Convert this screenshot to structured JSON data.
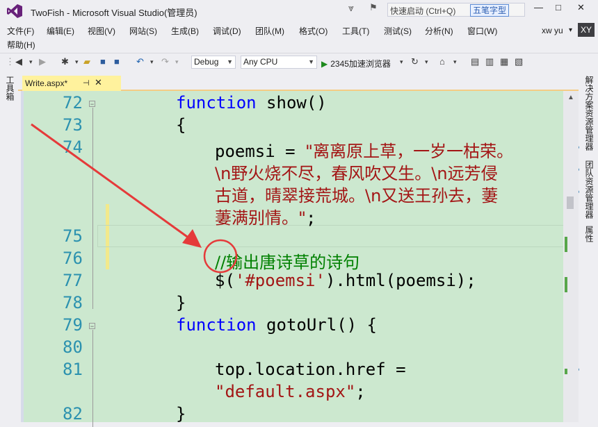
{
  "window": {
    "title": "TwoFish - Microsoft Visual Studio(管理员)",
    "quick_launch_placeholder": "快速启动 (Ctrl+Q)",
    "ime_label": "五笔字型",
    "minimize": "—",
    "maximize": "□",
    "close": "✕",
    "filter_icon": "⩔",
    "notify_icon": "⚑"
  },
  "menu": {
    "items": [
      "文件(F)",
      "编辑(E)",
      "视图(V)",
      "网站(S)",
      "生成(B)",
      "调试(D)",
      "团队(M)",
      "格式(O)",
      "工具(T)",
      "测试(S)",
      "分析(N)",
      "窗口(W)"
    ],
    "help": "帮助(H)",
    "user_name": "xw yu",
    "user_dropdown": "▾",
    "user_initials": "XY"
  },
  "toolbar": {
    "config": "Debug",
    "platform": "Any CPU",
    "run_target": "2345加速浏览器",
    "icons": [
      "back-icon",
      "forward-icon",
      "new-project-icon",
      "open-icon",
      "save-icon",
      "save-all-icon",
      "undo-icon",
      "redo-icon",
      "refresh-icon"
    ]
  },
  "left_panel": {
    "label": "工具箱"
  },
  "right_panel": {
    "labels": [
      "解决方案资源管理器",
      "团队资源管理器",
      "属性"
    ]
  },
  "tab": {
    "name": "Write.aspx*",
    "pin": "⊣",
    "close": "✕"
  },
  "editor": {
    "line_numbers": [
      "72",
      "73",
      "74",
      "",
      "",
      "",
      "75",
      "76",
      "77",
      "78",
      "79",
      "80",
      "81",
      "",
      "82"
    ],
    "l72_kw": "function",
    "l72_rest": " show()",
    "l73": "{",
    "l74_lhs": "poemsi = ",
    "l74_s1": "\"离离原上草，一岁一枯荣。",
    "l74_s2": "\\n野火烧不尽，春风吹又生。\\n远芳侵",
    "l74_s3": "古道，晴翠接荒城。\\n又送王孙去，萋",
    "l74_s4": "萋满别情。\"",
    "l74_end": ";",
    "l76_comment": "//输出唐诗草的诗句",
    "l77_a": "$(",
    "l77_str": "'#poemsi'",
    "l77_b": ").html(poemsi);",
    "l78": "}",
    "l79_kw": "function",
    "l79_rest": " gotoUrl() {",
    "l81_a": "top.location.href =",
    "l81_str": "\"default.aspx\"",
    "l81_end": ";",
    "l82": "}"
  },
  "colors": {
    "editor_bg": "#CCE8CF",
    "keyword": "#0000FF",
    "string": "#A31515",
    "comment": "#008000",
    "line_number": "#2B91AF",
    "annotation_red": "#E53A3A"
  }
}
